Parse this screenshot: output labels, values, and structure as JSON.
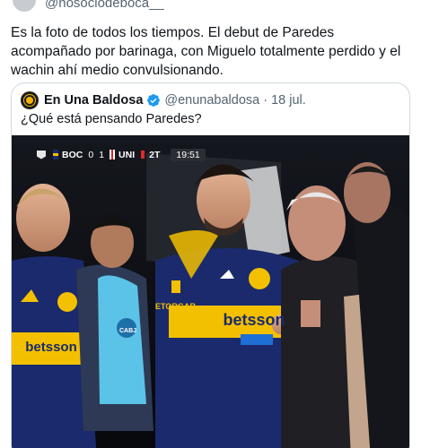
{
  "author": {
    "handle": "@nosociodeboca__"
  },
  "tweet": {
    "text": "Es la foto de todos los tiempos. El debut de Paredes acompañado por barinaga, con Miguelo totalmente perdido y el wachin ahí medio convulsionando."
  },
  "quoted": {
    "name": "En Una Baldosa",
    "handle": "@enunabaldosa",
    "separator": "·",
    "date": "18 jul.",
    "text": "¿Qué está pensando Paredes?"
  },
  "scorebug": {
    "home": "BOC",
    "home_score": "0",
    "away_score": "1",
    "away": "UNI",
    "period": "2T",
    "clock": "19:51"
  },
  "photo": {
    "shirt_sponsor_left": "betsson",
    "shirt_sponsor_center": "betsson",
    "shirt_brand": "ETORGAR",
    "badge_text": "CABJ"
  },
  "colors": {
    "boca_blue": "#1a2a6c",
    "boca_yellow": "#f3c000",
    "verified_blue": "#1d9bf0"
  }
}
